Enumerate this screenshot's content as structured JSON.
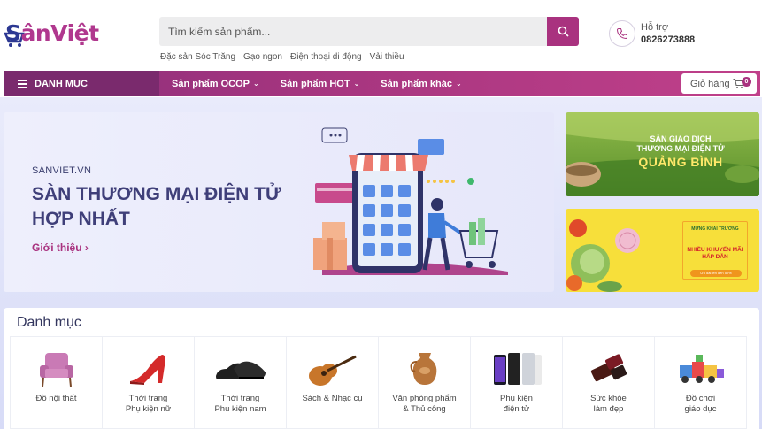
{
  "header": {
    "logo_s": "S",
    "logo_rest": "ânViệt",
    "search_placeholder": "Tìm kiếm sản phẩm...",
    "quick_links": [
      "Đặc sản Sóc Trăng",
      "Gạo ngon",
      "Điện thoại di động",
      "Vải thiều"
    ],
    "support_label": "Hỗ trợ",
    "support_phone": "0826273888"
  },
  "nav": {
    "category_label": "DANH MỤC",
    "items": [
      "Sản phẩm OCOP",
      "Sản phẩm HOT",
      "Sản phẩm khác"
    ],
    "cart_label": "Giỏ hàng",
    "cart_count": "0"
  },
  "banner": {
    "small": "SANVIET.VN",
    "title": "SÀN THƯƠNG MẠI ĐIỆN TỬ HỢP NHẤT",
    "link": "Giới thiệu",
    "link_arrow": "›"
  },
  "side_banner_1": {
    "line1": "SÀN GIAO DỊCH",
    "line2": "THƯƠNG MẠI ĐIỆN TỬ",
    "line3": "QUẢNG BÌNH"
  },
  "side_banner_2": {
    "line1": "MỪNG KHAI TRƯƠNG",
    "line2": "NHIỀU KHUYẾN MÃI HẤP DẪN",
    "button": "Ưu đãi lên đến 50%"
  },
  "categories": {
    "title": "Danh mục",
    "items": [
      {
        "line1": "Đồ nội thất",
        "line2": ""
      },
      {
        "line1": "Thời trang",
        "line2": "Phụ kiện nữ"
      },
      {
        "line1": "Thời trang",
        "line2": "Phụ kiện nam"
      },
      {
        "line1": "Sách & Nhạc cụ",
        "line2": ""
      },
      {
        "line1": "Văn phòng phẩm",
        "line2": "& Thủ công"
      },
      {
        "line1": "Phụ kiện",
        "line2": "điện tử"
      },
      {
        "line1": "Sức khỏe",
        "line2": "làm đẹp"
      },
      {
        "line1": "Đồ chơi",
        "line2": "giáo dục"
      }
    ]
  },
  "colors": {
    "brand_purple": "#a9327f",
    "brand_navy": "#2c3892"
  }
}
